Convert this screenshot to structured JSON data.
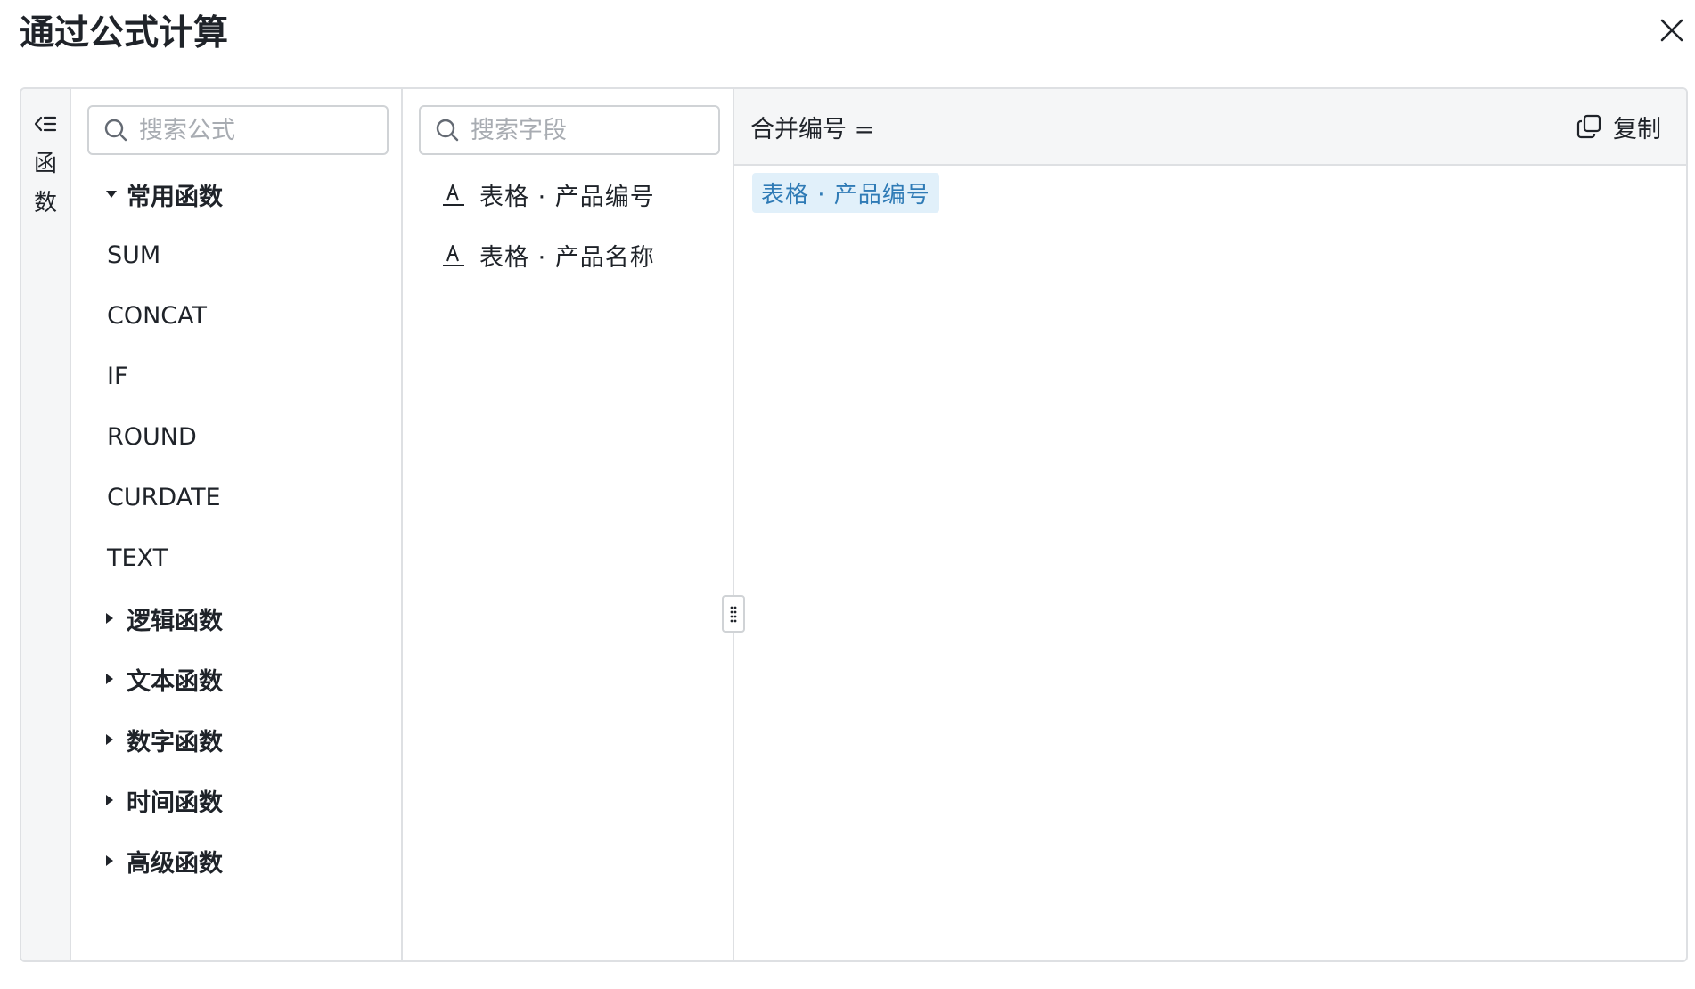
{
  "dialog": {
    "title": "通过公式计算"
  },
  "rail": {
    "label": "函数"
  },
  "functions": {
    "search_placeholder": "搜索公式",
    "group_common": "常用函数",
    "common_items": [
      "SUM",
      "CONCAT",
      "IF",
      "ROUND",
      "CURDATE",
      "TEXT"
    ],
    "groups": [
      "逻辑函数",
      "文本函数",
      "数字函数",
      "时间函数",
      "高级函数"
    ]
  },
  "fields": {
    "search_placeholder": "搜索字段",
    "items": [
      "表格 · 产品编号",
      "表格 · 产品名称"
    ]
  },
  "editor": {
    "formula_name": "合并编号 =",
    "copy_label": "复制",
    "token": "表格 · 产品编号"
  },
  "colors": {
    "token_bg": "#e1f0fa",
    "token_text": "#2f7bb6",
    "border": "#dee0e3",
    "header_bg": "#f5f6f7"
  }
}
